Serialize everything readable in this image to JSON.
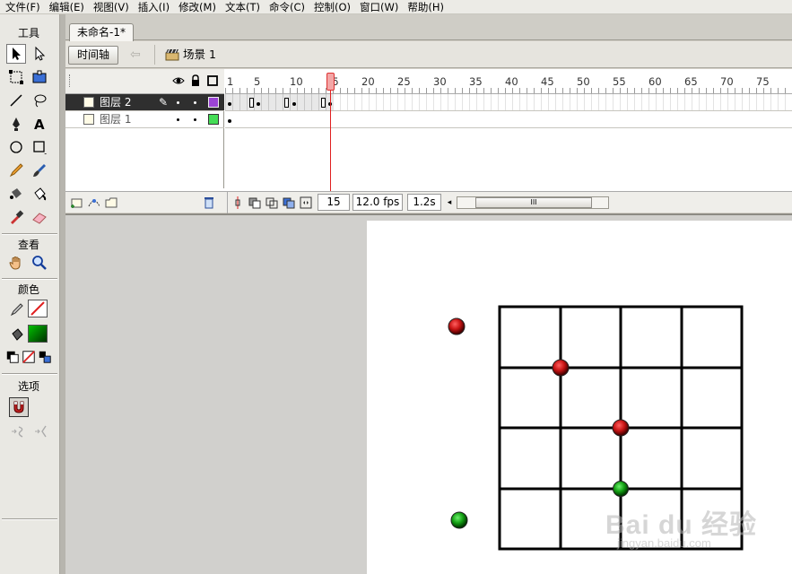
{
  "menu": [
    "文件(F)",
    "编辑(E)",
    "视图(V)",
    "插入(I)",
    "修改(M)",
    "文本(T)",
    "命令(C)",
    "控制(O)",
    "窗口(W)",
    "帮助(H)"
  ],
  "toolbox": {
    "tools_title": "工具",
    "view_title": "查看",
    "colors_title": "颜色",
    "options_title": "选项",
    "tool_icons": [
      "arrow-tool-icon",
      "subselection-tool-icon",
      "free-transform-tool-icon",
      "gradient-transform-tool-icon",
      "line-tool-icon",
      "lasso-tool-icon",
      "pen-tool-icon",
      "text-tool-icon",
      "oval-tool-icon",
      "rectangle-tool-icon",
      "pencil-tool-icon",
      "brush-tool-icon",
      "ink-bottle-tool-icon",
      "paint-bucket-tool-icon",
      "eyedropper-tool-icon",
      "eraser-tool-icon"
    ],
    "view_icons": [
      "hand-tool-icon",
      "zoom-tool-icon"
    ]
  },
  "document_tab": "未命名-1*",
  "editbar": {
    "timeline_button": "时间轴",
    "scene_label": "场景 1"
  },
  "timeline": {
    "frame_numbers": [
      "1",
      "5",
      "10",
      "15",
      "20",
      "25",
      "30",
      "35",
      "40",
      "45",
      "50",
      "55",
      "60",
      "65",
      "70",
      "75"
    ],
    "layers": [
      {
        "name": "图层 2",
        "selected": true,
        "color": "#9b44d4"
      },
      {
        "name": "图层 1",
        "selected": false,
        "color": "#44dd55"
      }
    ],
    "current_frame": "15",
    "frame_rate": "12.0 fps",
    "elapsed_time": "1.2s",
    "scroll_thumb": "III"
  },
  "stage": {
    "background": "#ffffff",
    "grid": {
      "cols": 4,
      "rows": 4,
      "line_color": "#000000"
    },
    "balls": [
      {
        "name": "red-ball",
        "color": "#c81414"
      },
      {
        "name": "red-ball",
        "color": "#c81414"
      },
      {
        "name": "red-ball",
        "color": "#c81414"
      },
      {
        "name": "green-ball",
        "color": "#14a014"
      },
      {
        "name": "green-ball",
        "color": "#14a014"
      }
    ]
  },
  "watermark": {
    "logo": "Bai du 经验",
    "url": "jingyan.baidu.com"
  },
  "colors": {
    "accent": "#e02020",
    "selected_layer": "#2f2f2f"
  }
}
